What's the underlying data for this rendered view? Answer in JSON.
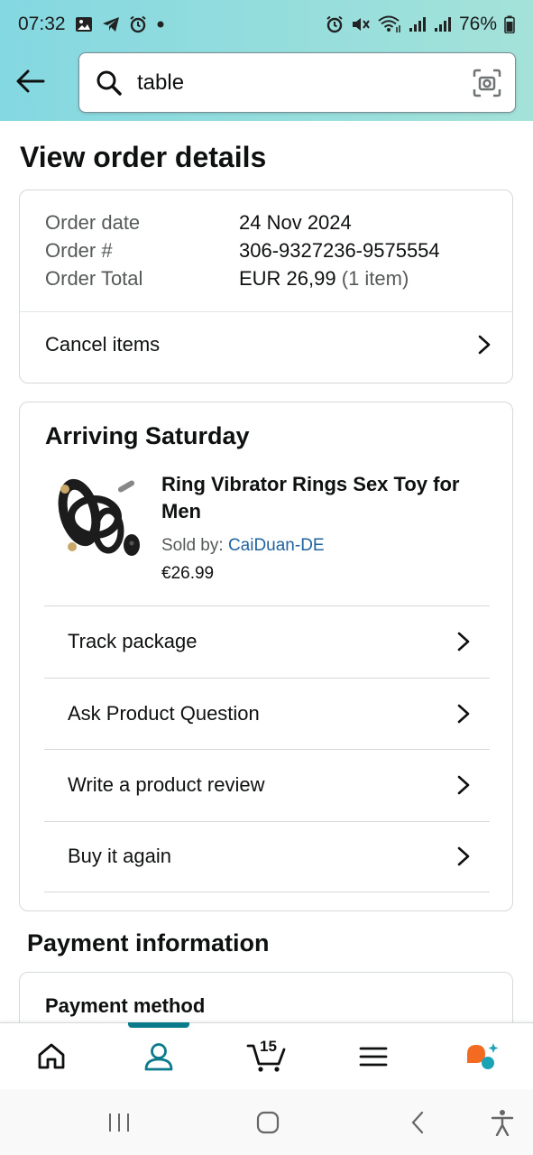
{
  "status_bar": {
    "time": "07:32",
    "battery": "76%",
    "left_icons": [
      "gallery-icon",
      "telegram-icon",
      "alarm-icon",
      "dot-icon"
    ],
    "right_icons": [
      "alarm-icon",
      "mute-icon",
      "wifi-icon",
      "signal-icon",
      "signal-icon",
      "battery-icon"
    ]
  },
  "search": {
    "value": "table",
    "placeholder": ""
  },
  "page": {
    "title": "View order details"
  },
  "order_summary": {
    "date_label": "Order date",
    "date_value": "24 Nov 2024",
    "number_label": "Order #",
    "number_value": "306-9327236-9575554",
    "total_label": "Order Total",
    "total_value": "EUR 26,99",
    "total_items": "(1 item)",
    "cancel_label": "Cancel items"
  },
  "shipment": {
    "title": "Arriving Saturday",
    "product_name": "Ring Vibrator Rings Sex Toy for Men",
    "sold_by_label": "Sold by:",
    "seller": "CaiDuan-DE",
    "price": "€26.99",
    "actions": [
      {
        "label": "Track package"
      },
      {
        "label": "Ask Product Question"
      },
      {
        "label": "Write a product review"
      },
      {
        "label": "Buy it again"
      }
    ]
  },
  "payment": {
    "section_title": "Payment information",
    "method_title": "Payment method"
  },
  "bottom_nav": {
    "active": "account",
    "cart_count": "15",
    "accent_color": "#0b7b8b"
  }
}
